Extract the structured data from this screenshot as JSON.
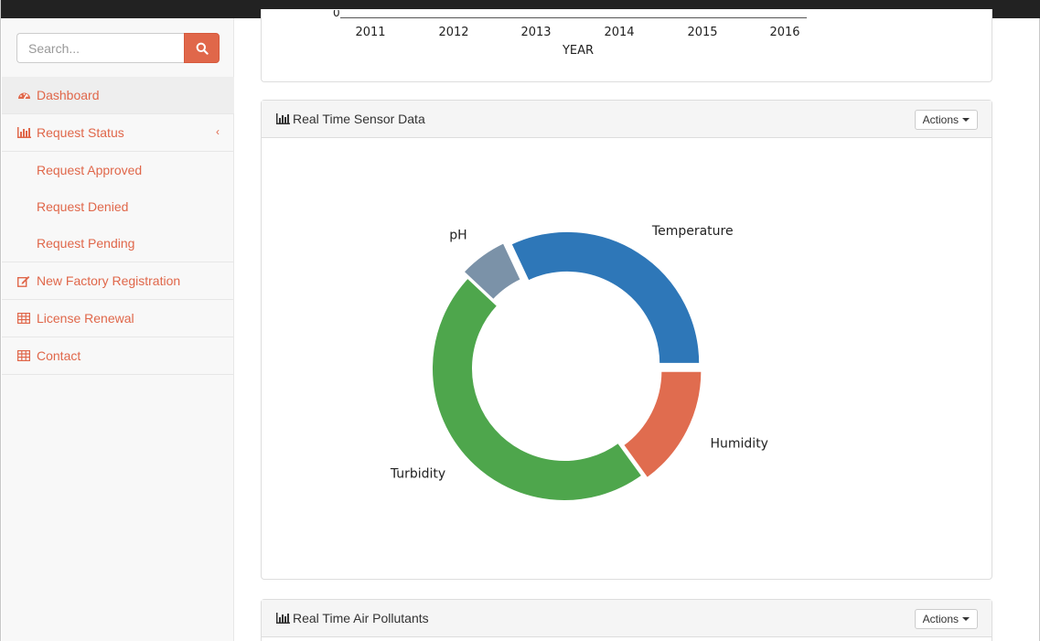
{
  "search": {
    "placeholder": "Search..."
  },
  "nav": {
    "dashboard": "Dashboard",
    "request_status": "Request Status",
    "request_approved": "Request Approved",
    "request_denied": "Request Denied",
    "request_pending": "Request Pending",
    "new_factory": "New Factory Registration",
    "license_renewal": "License Renewal",
    "contact": "Contact"
  },
  "top_chart": {
    "zero_tick": "0",
    "years": [
      "2011",
      "2012",
      "2013",
      "2014",
      "2015",
      "2016"
    ],
    "xlabel": "YEAR"
  },
  "sensor_panel": {
    "title": "Real Time Sensor Data",
    "actions_label": "Actions"
  },
  "air_panel": {
    "title": "Real Time Air Pollutants",
    "actions_label": "Actions"
  },
  "colors": {
    "accent": "#e0674a",
    "temperature": "#2e77b8",
    "humidity": "#e06c4f",
    "turbidity": "#4ea64c",
    "ph": "#7b92a8"
  },
  "chart_data": {
    "type": "pie",
    "donut": true,
    "slices": [
      {
        "label": "Humidity",
        "value": 15,
        "color": "#e06c4f"
      },
      {
        "label": "Turbidity",
        "value": 47,
        "color": "#4ea64c"
      },
      {
        "label": "pH",
        "value": 6,
        "color": "#7b92a8"
      },
      {
        "label": "Temperature",
        "value": 32,
        "color": "#2e77b8"
      }
    ]
  }
}
